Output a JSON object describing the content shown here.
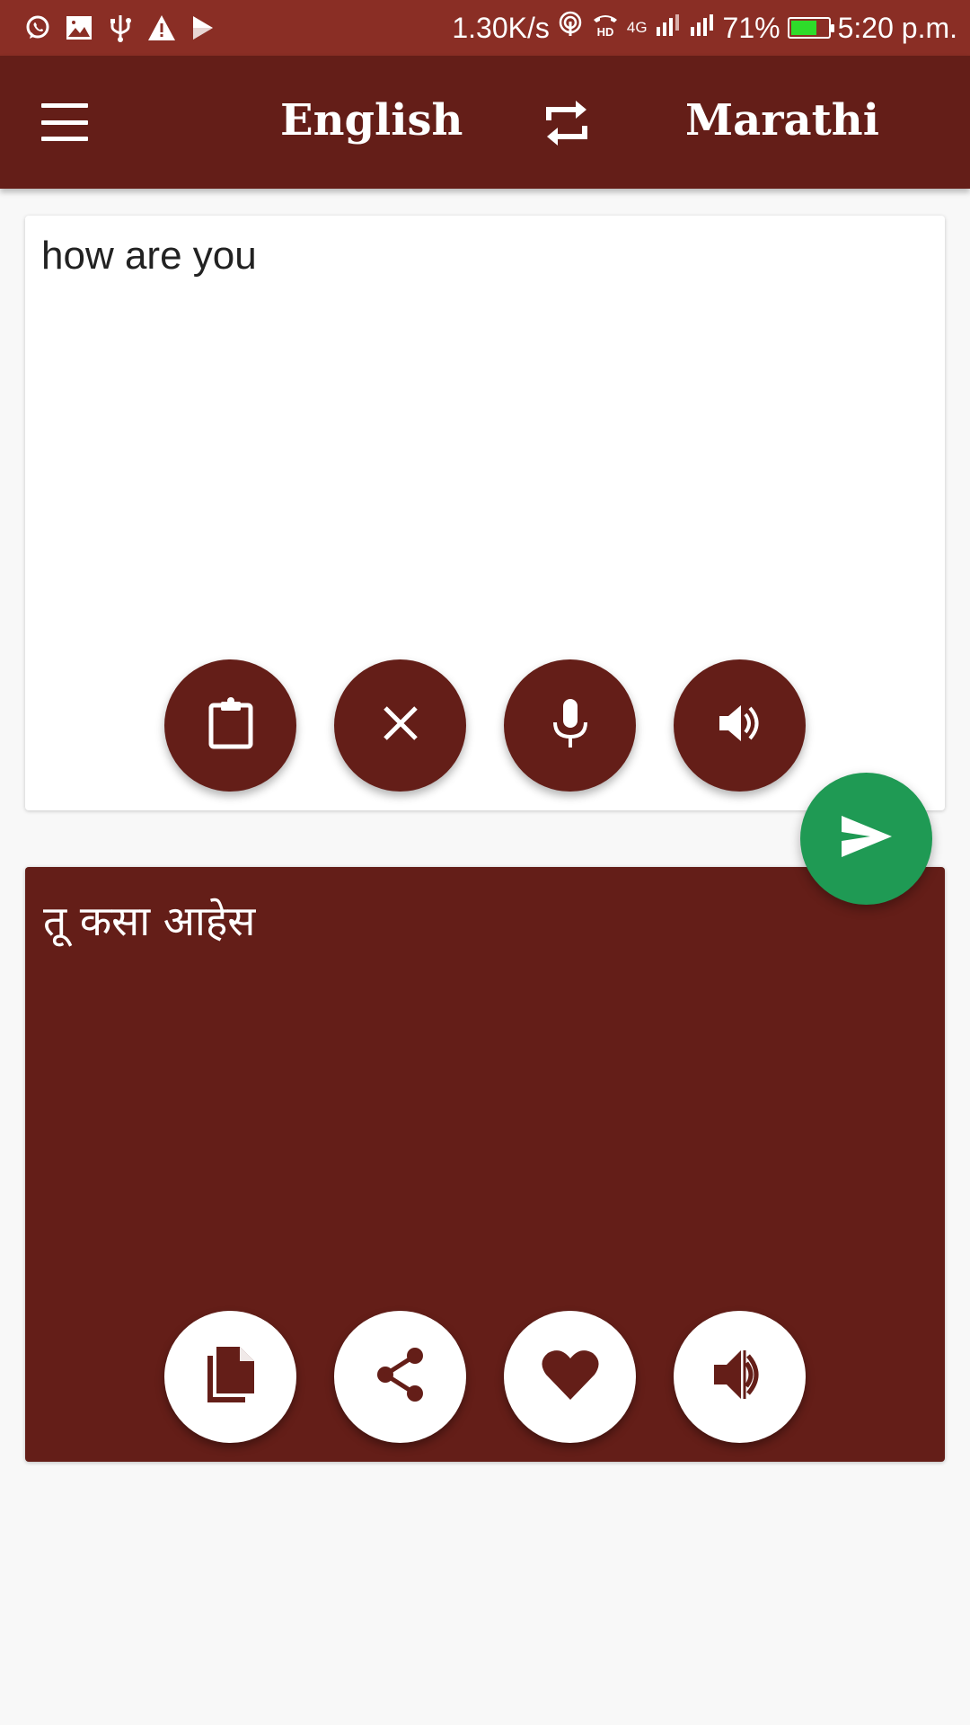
{
  "status_bar": {
    "left_icons": [
      "whatsapp-icon",
      "image-icon",
      "usb-icon",
      "warning-icon",
      "play-store-icon"
    ],
    "network_speed": "1.30K/s",
    "hotspot_icon": "hotspot-icon",
    "hd_call_icon": "hd-voice-icon",
    "network_type": "4G",
    "signal_sim1_icon": "signal-sim1-icon",
    "signal_sim2_icon": "signal-sim2-icon",
    "battery_percent": "71%",
    "battery_level": 0.71,
    "battery_color": "#2edc2a",
    "time": "5:20 p.m."
  },
  "app_bar": {
    "menu_icon": "hamburger-menu-icon",
    "source_language": "English",
    "swap_icon": "swap-languages-icon",
    "target_language": "Marathi",
    "color": "#641e18"
  },
  "input": {
    "text": "how are you",
    "actions": [
      {
        "name": "paste",
        "icon": "clipboard-icon"
      },
      {
        "name": "clear",
        "icon": "close-icon"
      },
      {
        "name": "voice-input",
        "icon": "microphone-icon"
      },
      {
        "name": "speak-input",
        "icon": "speaker-icon"
      }
    ]
  },
  "translate_button": {
    "icon": "send-icon",
    "color": "#1f9a54"
  },
  "output": {
    "text": "तू कसा आहेस",
    "actions": [
      {
        "name": "copy",
        "icon": "copy-icon"
      },
      {
        "name": "share",
        "icon": "share-icon"
      },
      {
        "name": "favorite",
        "icon": "heart-icon"
      },
      {
        "name": "speak-output",
        "icon": "speaker-icon"
      }
    ]
  }
}
